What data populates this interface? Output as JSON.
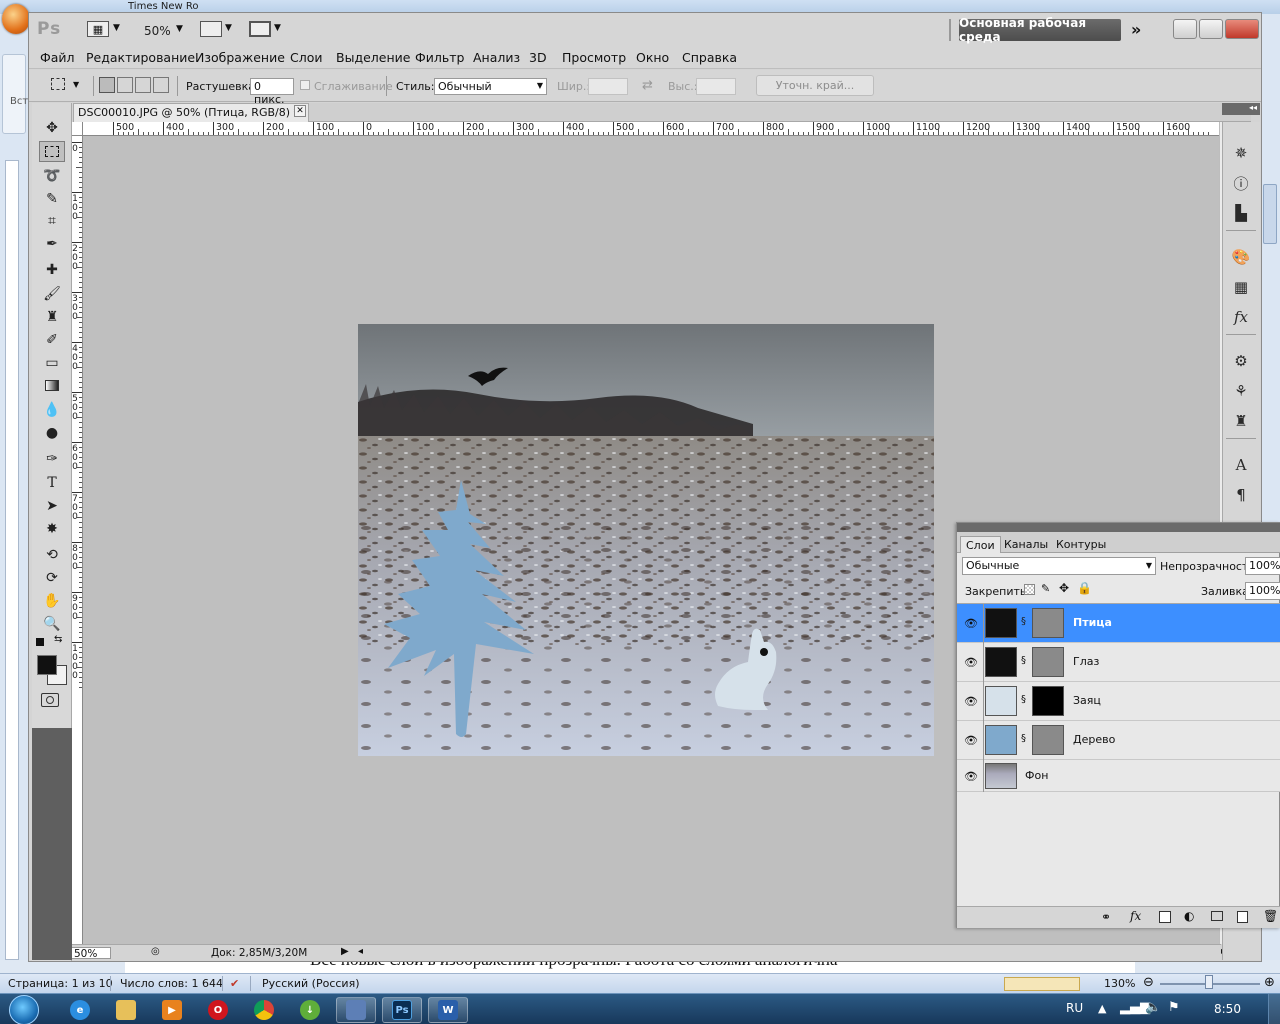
{
  "word": {
    "title_fragment": "Times New Ro",
    "left_label": "Вст",
    "doc_text": "Все новые слои в изображении прозрачны. Работа со слоями аналогична",
    "status": {
      "page": "Страница: 1 из 10",
      "words": "Число слов: 1 644",
      "language": "Русский (Россия)",
      "zoom": "130%"
    }
  },
  "photoshop": {
    "logo": "Ps",
    "zoom": "50%",
    "workspace": "Основная рабочая среда",
    "menu": [
      "Файл",
      "Редактирование",
      "Изображение",
      "Слои",
      "Выделение",
      "Фильтр",
      "Анализ",
      "3D",
      "Просмотр",
      "Окно",
      "Справка"
    ],
    "options": {
      "feather_label": "Растушевка:",
      "feather_value": "0 пикс.",
      "antialias_label": "Сглаживание",
      "style_label": "Стиль:",
      "style_value": "Обычный",
      "width_label": "Шир.:",
      "height_label": "Выс.:",
      "refine_edge": "Уточн. край..."
    },
    "document": {
      "tab_title": "DSC00010.JPG @ 50% (Птица, RGB/8) *",
      "status_zoom": "50%",
      "status_doc": "Док: 2,85M/3,20M"
    },
    "ruler_h": [
      "500",
      "400",
      "300",
      "200",
      "100",
      "0",
      "100",
      "200",
      "300",
      "400",
      "500",
      "600",
      "700",
      "800",
      "900",
      "1000",
      "1100",
      "1200",
      "1300",
      "1400",
      "1500",
      "1600"
    ],
    "ruler_v": [
      "0",
      "1\n0\n0",
      "2\n0\n0",
      "3\n0\n0",
      "4\n0\n0",
      "5\n0\n0",
      "6\n0\n0",
      "7\n0\n0",
      "8\n0\n0",
      "9\n0\n0",
      "1\n0\n0\n0"
    ],
    "layers_panel": {
      "tabs": [
        "Слои",
        "Каналы",
        "Контуры"
      ],
      "blend_mode": "Обычные",
      "opacity_label": "Непрозрачность:",
      "opacity_value": "100%",
      "lock_label": "Закрепить:",
      "fill_label": "Заливка:",
      "fill_value": "100%",
      "layers": [
        {
          "name": "Птица",
          "selected": true
        },
        {
          "name": "Глаз",
          "selected": false
        },
        {
          "name": "Заяц",
          "selected": false
        },
        {
          "name": "Дерево",
          "selected": false
        },
        {
          "name": "Фон",
          "selected": false
        }
      ]
    }
  },
  "taskbar": {
    "language": "RU",
    "time": "8:50"
  },
  "colors": {
    "selection_blue": "#3d8fff",
    "tree_blue": "#7fa9cc",
    "hare_white": "#d6e1ea"
  }
}
